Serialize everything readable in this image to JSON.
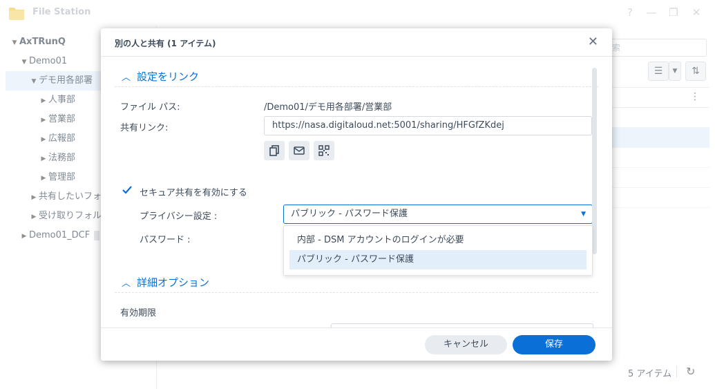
{
  "app": {
    "title": "File Station",
    "window_buttons": [
      "?",
      "—",
      "❐",
      "✕"
    ]
  },
  "sidebar": {
    "root": "AxTRunQ",
    "items": [
      {
        "label": "Demo01"
      },
      {
        "label": "デモ用各部署"
      },
      {
        "label": "人事部"
      },
      {
        "label": "営業部"
      },
      {
        "label": "広報部"
      },
      {
        "label": "法務部"
      },
      {
        "label": "管理部"
      },
      {
        "label": "共有したいフォ"
      },
      {
        "label": "受け取りフォル"
      },
      {
        "label": "Demo01_DCF"
      }
    ]
  },
  "main": {
    "search_placeholder": "索",
    "footer_count": "5 アイテム"
  },
  "dialog": {
    "title": "別の人と共有 (1 アイテム)",
    "link_section": "設定をリンク",
    "file_path_label": "ファイル パス:",
    "file_path_value": "/Demo01/デモ用各部署/営業部",
    "share_link_label": "共有リンク:",
    "share_link_value": "https://nasa.digitaloud.net:5001/sharing/HFGfZKdej",
    "secure_share_label": "セキュア共有を有効にする",
    "secure_share_checked": true,
    "privacy_label": "プライバシー設定 :",
    "privacy_value": "パブリック - パスワード保護",
    "privacy_options": [
      "内部 - DSM アカウントのログインが必要",
      "パブリック - パスワード保護"
    ],
    "password_label": "パスワード :",
    "advanced_section": "詳細オプション",
    "expiry_label": "有効期限",
    "cancel_label": "キャンセル",
    "save_label": "保存"
  },
  "colors": {
    "accent": "#0a6fd7",
    "selection": "#e3eefb"
  }
}
